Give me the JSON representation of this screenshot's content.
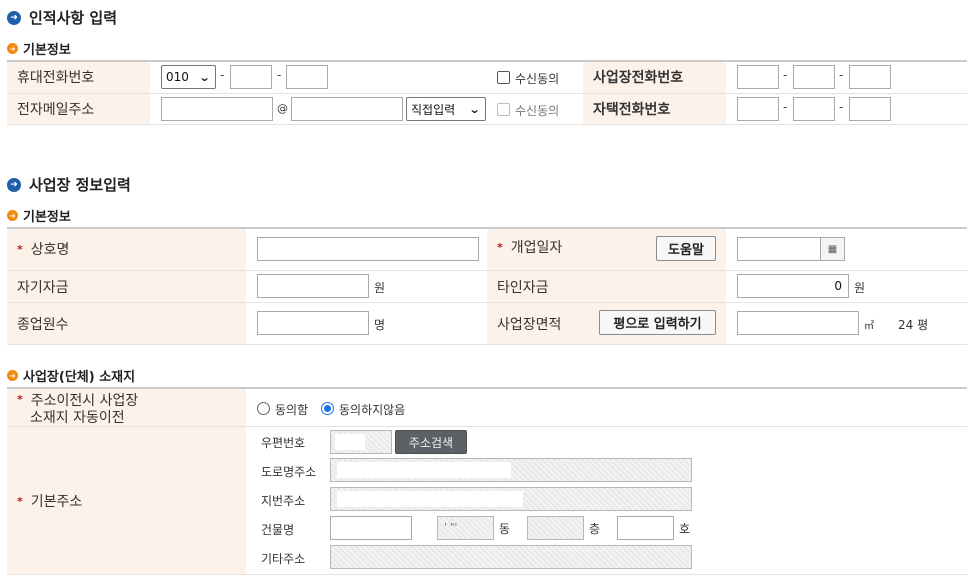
{
  "personal": {
    "title": "인적사항 입력",
    "basic": "기본정보",
    "mobile_label": "휴대전화번호",
    "mobile_prefix": "010",
    "sms_consent": "수신동의",
    "office_phone_label": "사업장전화번호",
    "email_label": "전자메일주소",
    "at": "@",
    "email_domain_select": "직접입력",
    "email_consent": "수신동의",
    "home_phone_label": "자택전화번호",
    "dash": "-"
  },
  "business": {
    "title": "사업장 정보입력",
    "basic": "기본정보",
    "required_mark": "*",
    "trade_name_label": "상호명",
    "open_date_label": "개업일자",
    "help_button": "도움말",
    "own_capital_label": "자기자금",
    "won": "원",
    "other_capital_label": "타인자금",
    "other_capital_value": "0",
    "employees_label": "종업원수",
    "persons_unit": "명",
    "area_label": "사업장면적",
    "pyeong_button": "평으로 입력하기",
    "area_unit": "㎡",
    "pyeong_display": "24 평"
  },
  "address": {
    "title": "사업장(단체) 소재지",
    "auto_transfer_label_1": "주소이전시 사업장",
    "auto_transfer_label_2": "소재지 자동이전",
    "agree": "동의함",
    "disagree": "동의하지않음",
    "base_address_label": "기본주소",
    "postal_label": "우편번호",
    "search_button": "주소검색",
    "road_label": "도로명주소",
    "lot_label": "지번주소",
    "building_label": "건물명",
    "dong": "동",
    "floor": "층",
    "ho": "호",
    "other_label": "기타주소",
    "building_dong_value": "' \"'"
  },
  "icons": {
    "section_bullet": "arrow-right-circle-icon",
    "sub_bullet": "orange-arrow-circle-icon",
    "calendar": "calendar-icon"
  },
  "colors": {
    "header_cell_bg": "#fdf2ea",
    "section_bullet": "#1d5fa8",
    "sub_bullet": "#f08a12",
    "required": "#c01818",
    "radio_selected": "#1a73e8"
  }
}
